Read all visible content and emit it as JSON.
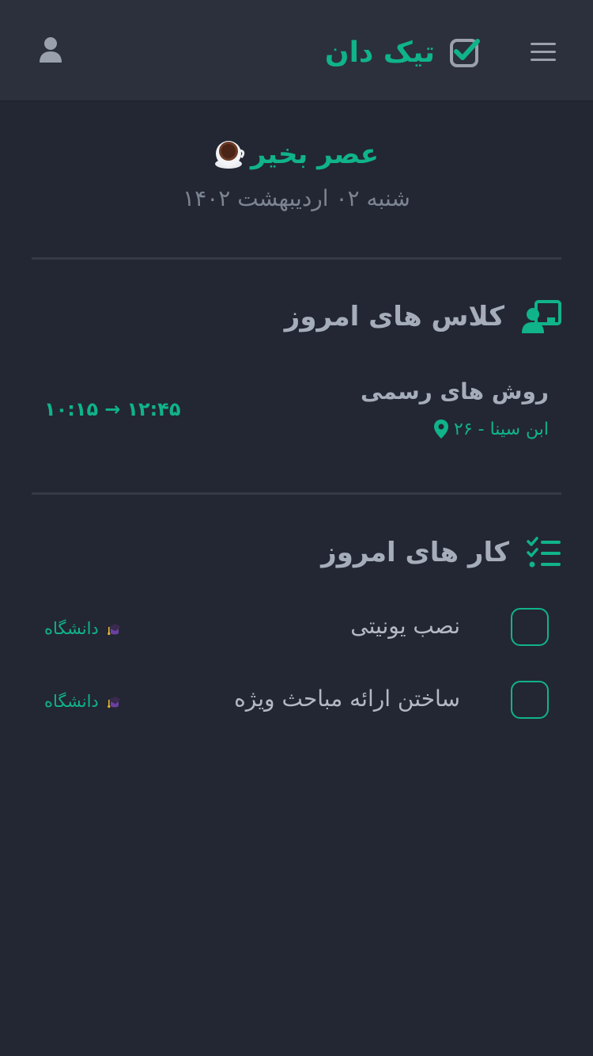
{
  "header": {
    "app_name": "تیک دان",
    "menu_icon": "hamburger-menu-icon",
    "logo_icon": "check-square-icon",
    "user_icon": "user-icon"
  },
  "greeting": {
    "text": "عصر بخیر",
    "icon": "coffee-cup-icon",
    "date": "شنبه ۰۲ اردیبهشت ۱۴۰۲"
  },
  "classes": {
    "title": "کلاس های امروز",
    "icon": "chalkboard-teacher-icon",
    "items": [
      {
        "name": "روش های رسمی",
        "location": "ابن سینا - ۲۶",
        "start_time": "۱۰:۱۵",
        "arrow": "→",
        "end_time": "۱۲:۴۵"
      }
    ]
  },
  "tasks": {
    "title": "کار های امروز",
    "icon": "task-list-check-icon",
    "items": [
      {
        "title": "نصب یونیتی",
        "tag": "دانشگاه",
        "tag_icon": "graduation-cap-icon",
        "checked": false
      },
      {
        "title": "ساختن ارائه مباحث ویژه",
        "tag": "دانشگاه",
        "tag_icon": "graduation-cap-icon",
        "checked": false
      }
    ]
  },
  "colors": {
    "accent": "#10b38a",
    "background": "#232733",
    "header_bg": "#2b303c",
    "heading_text": "#a6adba",
    "muted_text": "#7d8491"
  }
}
